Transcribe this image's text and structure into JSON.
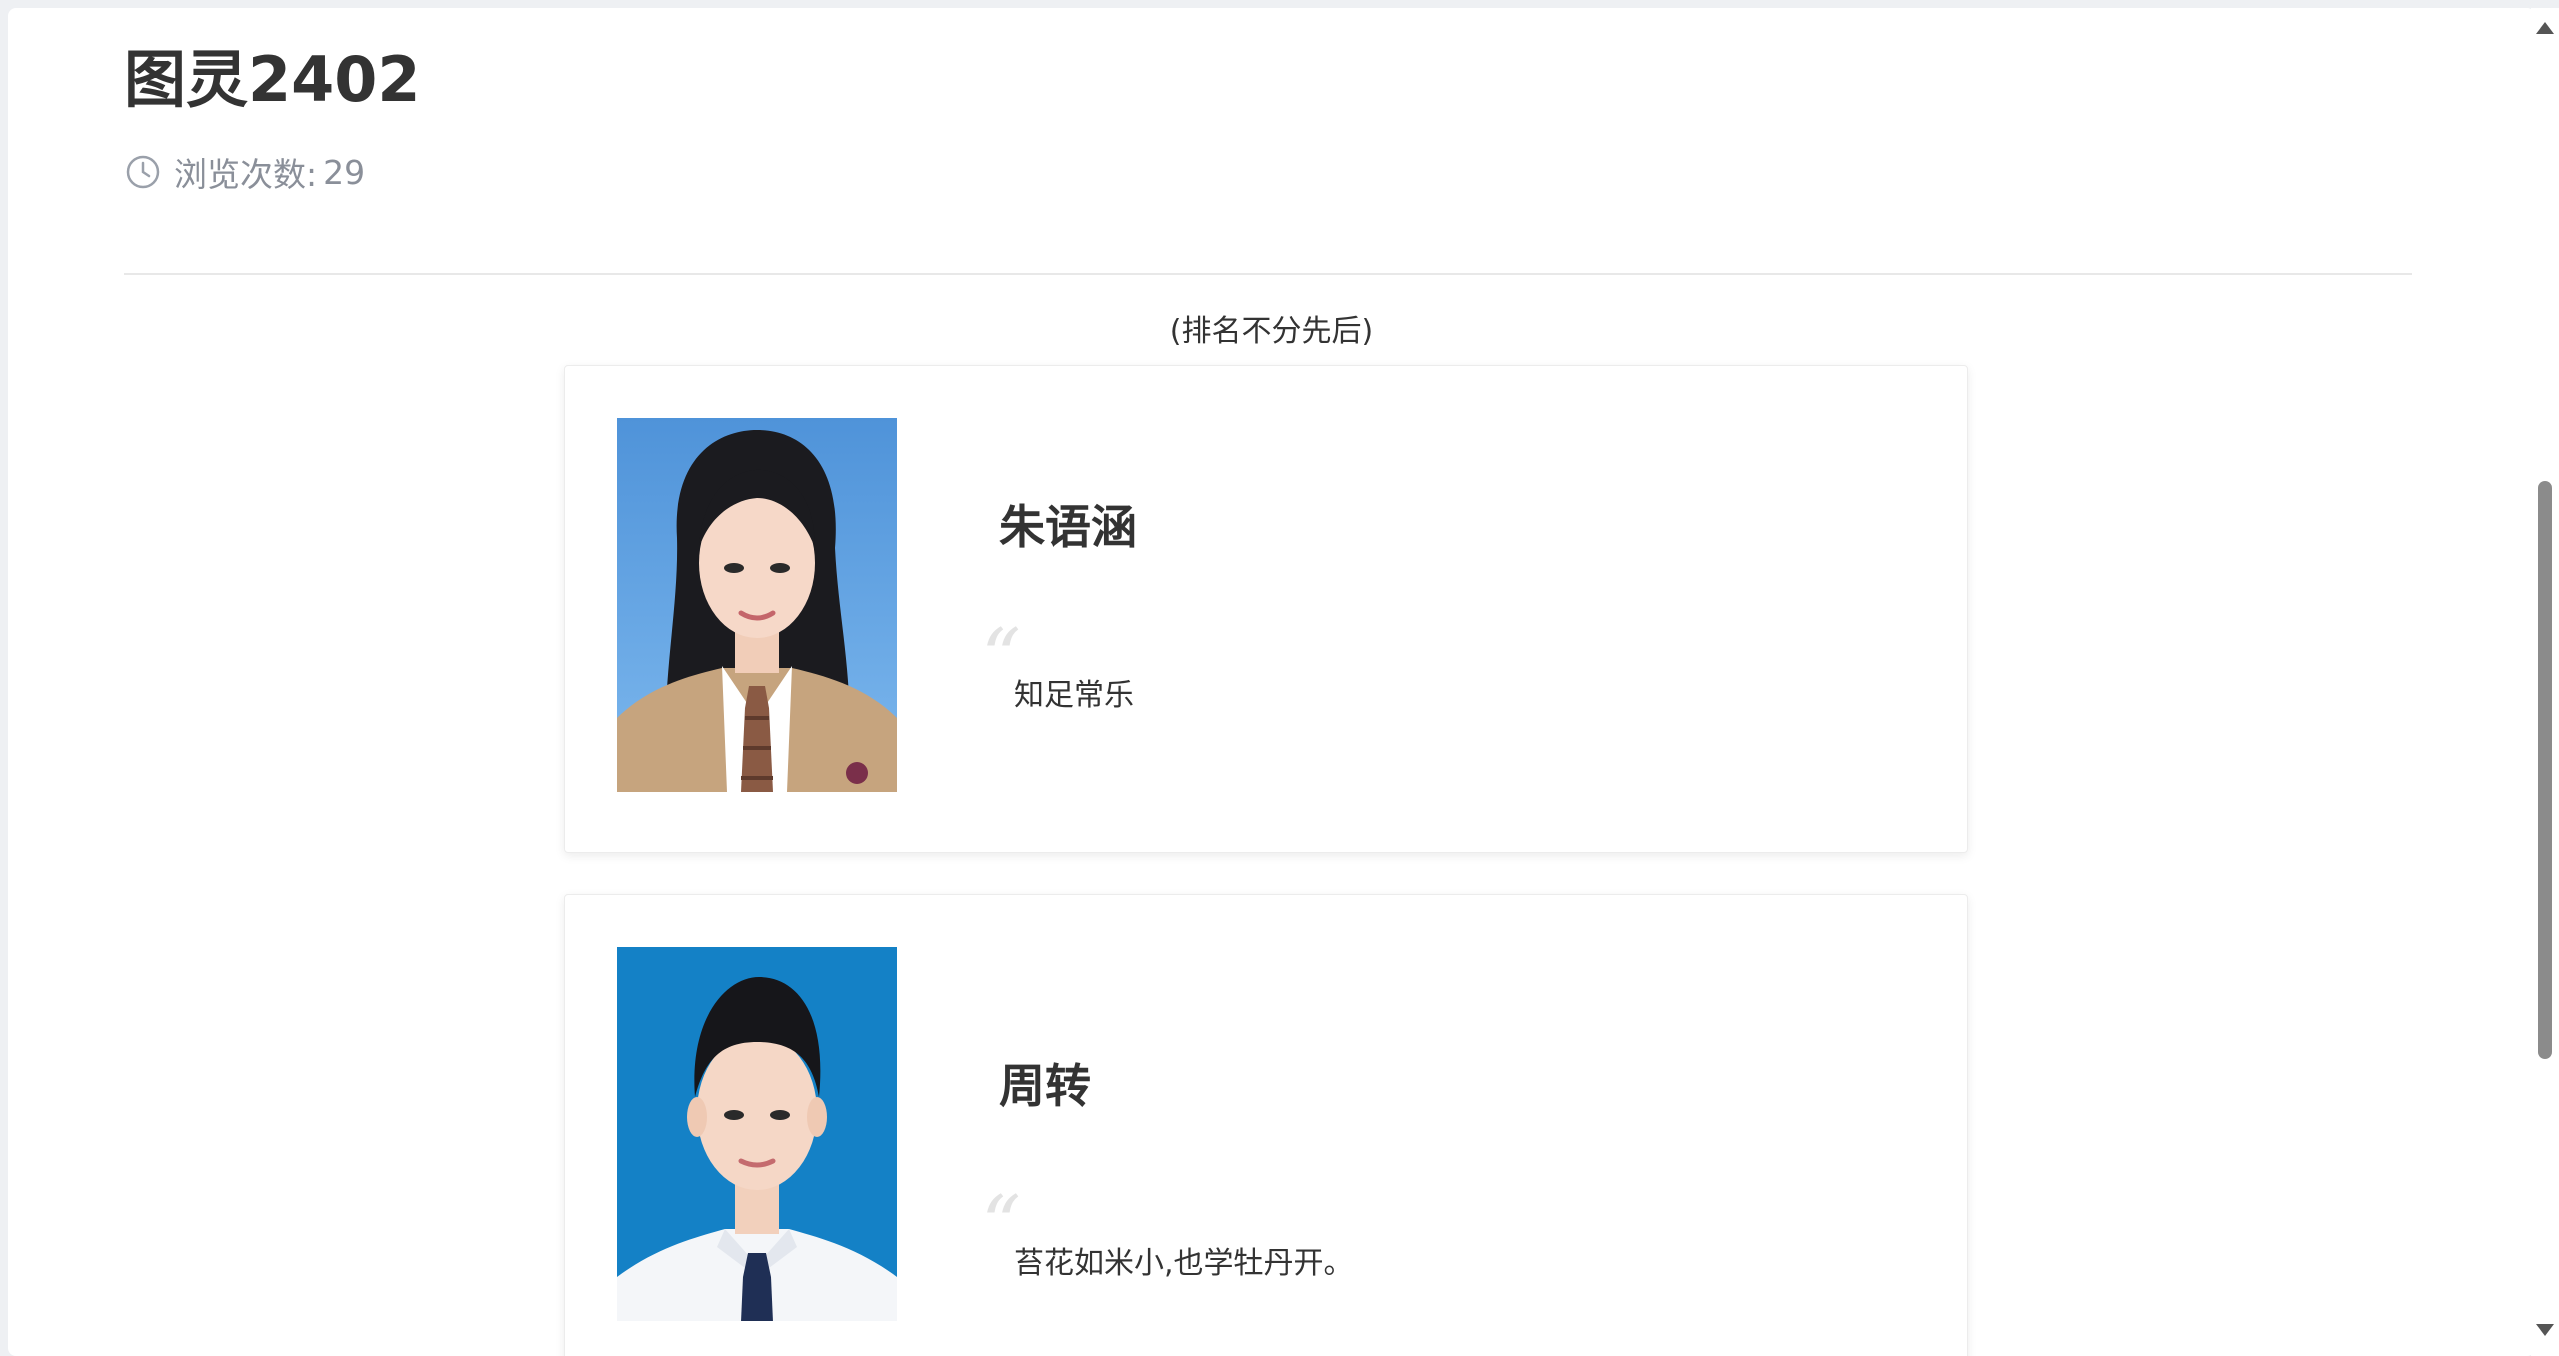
{
  "page": {
    "title": "图灵2402",
    "views_label": "浏览次数:",
    "views_count": "29",
    "clock_icon": "clock-icon"
  },
  "list": {
    "note": "(排名不分先后)",
    "people": [
      {
        "name": "朱语涵",
        "quote_mark": "“",
        "motto": "知足常乐",
        "photo_bg": "#5b9fe0"
      },
      {
        "name": "周转",
        "quote_mark": "“",
        "motto": "苔花如米小,也学牡丹开。",
        "photo_bg": "#1481c6"
      }
    ]
  },
  "colors": {
    "text": "#333333",
    "muted": "#8a8f99",
    "divider": "#e8e8e8",
    "quote": "#e3e3e3"
  }
}
